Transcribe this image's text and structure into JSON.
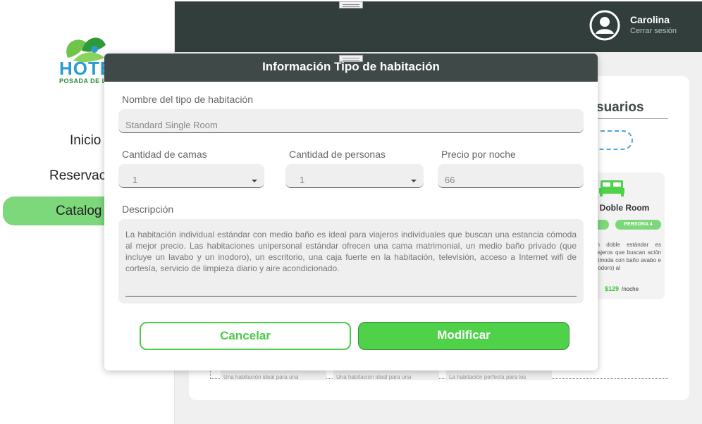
{
  "sidebar": {
    "logo_text": "HOTE",
    "logo_sub": "POSADA DE L",
    "items": [
      {
        "label": "Inicio"
      },
      {
        "label": "Reservac"
      },
      {
        "label": "Catalog"
      }
    ]
  },
  "header": {
    "user_name": "Carolina",
    "logout_label": "Cerrar sesión"
  },
  "background": {
    "section_title": "suarios",
    "room_card": {
      "title": "d Doble Room",
      "badges": [
        "",
        "PERSONA 4"
      ],
      "description": "ón doble estándar es viajeros que buscan ación cómoda con baño avabo e inodoro) al",
      "price": "$129",
      "unit": "/noche"
    },
    "mini_cards": [
      "Una habitación ideal para una",
      "Una habitación ideal para una",
      "La habitación perfecta para los"
    ]
  },
  "dialog": {
    "title": "Información Tipo de habitación",
    "name_label": "Nombre del tipo de habitación",
    "name_value": "Standard Single Room",
    "beds_label": "Cantidad de camas",
    "beds_value": "1",
    "people_label": "Cantidad de personas",
    "people_value": "1",
    "price_label": "Precio por noche",
    "price_value": "66",
    "description_label": "Descripción",
    "description_value": "La habitación individual estándar con medio baño es ideal para viajeros individuales que buscan una estancia cómoda al mejor precio. Las habitaciones unipersonal estándar ofrecen una cama matrimonial, un medio baño privado (que incluye un lavabo y un inodoro), un escritorio, una caja fuerte en la habitación, televisión, acceso a Internet wifi de cortesía, servicio de limpieza diario y aire acondicionado.",
    "cancel_label": "Cancelar",
    "modify_label": "Modificar"
  },
  "colors": {
    "accent_green": "#4fd14a",
    "header_dark": "#323e3c",
    "dialog_header": "#3f4947"
  },
  "icons": [
    "hotel-logo-icon",
    "user-avatar-icon",
    "bed-icon",
    "chevron-down-icon",
    "drag-handle-icon"
  ]
}
